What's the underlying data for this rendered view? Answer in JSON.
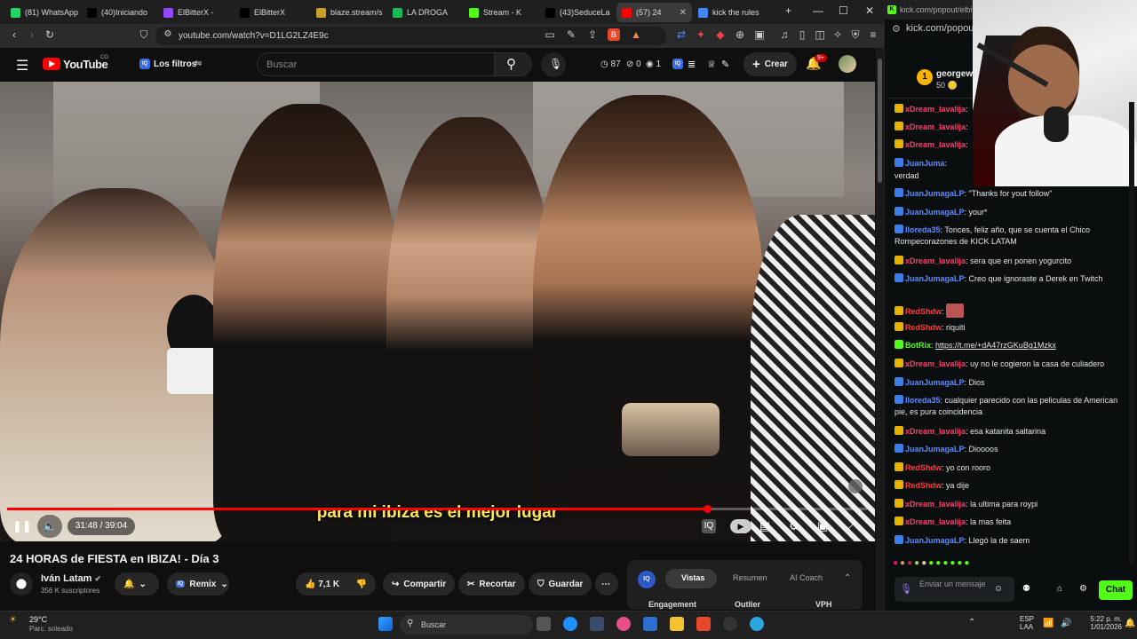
{
  "browser": {
    "tabs": [
      {
        "label": "(81) WhatsApp",
        "color": "#25d366",
        "icon": "whatsapp-icon"
      },
      {
        "label": "(40)Iniciando",
        "color": "#000000",
        "icon": "tiktok-icon"
      },
      {
        "label": "ElBitterX -",
        "color": "#9146ff",
        "icon": "twitch-icon"
      },
      {
        "label": "ElBitterX",
        "color": "#000000",
        "icon": "x-icon"
      },
      {
        "label": "blaze.stream/s",
        "color": "#c8a12a",
        "icon": "blaze-icon"
      },
      {
        "label": "LA DROGA",
        "color": "#1db954",
        "icon": "spotify-icon"
      },
      {
        "label": "Stream - K",
        "color": "#53fc18",
        "icon": "kick-icon"
      },
      {
        "label": "(43)SeduceLa",
        "color": "#000000",
        "icon": "tiktok-icon"
      },
      {
        "label": "(57) 24",
        "color": "#ff0000",
        "icon": "youtube-icon",
        "active": true
      },
      {
        "label": "kick the rules",
        "color": "#4285f4",
        "icon": "google-icon"
      }
    ],
    "url": "youtube.com/watch?v=D1LG2LZ4E9c"
  },
  "youtube": {
    "logo_text": "YouTube",
    "logo_sup": "CO",
    "filters_label": "Los filtros",
    "search_placeholder": "Buscar",
    "stats": {
      "a": "87",
      "b": "0",
      "c": "1"
    },
    "create_label": "Crear",
    "notif_count": "9+",
    "player": {
      "subtitle": "para mi ibiza es el mejor lugar",
      "time": "31:48 / 39:04",
      "progress": 0.814
    },
    "video_title": "24 HORAS de FIESTA en IBIZA! - Día 3",
    "channel_name": "Iván Latam",
    "subscribers": "356 K suscriptores",
    "remix_label": "Remix",
    "likes": "7,1 K",
    "share_label": "Compartir",
    "clip_label": "Recortar",
    "save_label": "Guardar",
    "insights": {
      "tabs": [
        "Vistas",
        "Resumen",
        "AI Coach"
      ],
      "columns": [
        "Engagement",
        "Outlier",
        "VPH"
      ]
    }
  },
  "kick": {
    "popout_url_top": "kick.com/popout/elbitt",
    "popout_url": "kick.com/popout/",
    "top_user": "georgew",
    "top_user_points": "50",
    "chat": [
      {
        "user": "xDream_lavalija",
        "color": "#ff3b6b",
        "msg": ""
      },
      {
        "user": "xDream_lavalija",
        "color": "#ff3b6b",
        "msg": ""
      },
      {
        "user": "xDream_lavalija",
        "color": "#ff3b6b",
        "msg": ""
      },
      {
        "user": "JuanJuma",
        "color": "#5b8cff",
        "msg": ""
      },
      {
        "user": "",
        "color": "#e6e6e6",
        "msg": "verdad"
      },
      {
        "user": "JuanJumagaLP",
        "color": "#5b8cff",
        "msg": "\"Thanks for yout follow\""
      },
      {
        "user": "JuanJumagaLP",
        "color": "#5b8cff",
        "msg": "your*"
      },
      {
        "user": "lloreda35",
        "color": "#5b8cff",
        "msg": "Tonces, feliz año, que se cuenta el Chico Rompecorazones de KICK LATAM"
      },
      {
        "user": "xDream_lavalija",
        "color": "#ff3b6b",
        "msg": "sera que en ponen yogurcito"
      },
      {
        "user": "JuanJumagaLP",
        "color": "#5b8cff",
        "msg": "Creo que ignoraste a Derek en Twitch"
      },
      {
        "user": "RedShdw",
        "color": "#ff3b3b",
        "msg": ""
      },
      {
        "user": "RedShdw",
        "color": "#ff3b3b",
        "msg": "riquiti"
      },
      {
        "user": "BotRix",
        "color": "#53fc18",
        "msg": "https://t.me/+dA47rzGKuBg1Mzkx"
      },
      {
        "user": "xDream_lavalija",
        "color": "#ff3b6b",
        "msg": "uy no le cogieron la casa de culiadero"
      },
      {
        "user": "JuanJumagaLP",
        "color": "#5b8cff",
        "msg": "Dios"
      },
      {
        "user": "lloreda35",
        "color": "#5b8cff",
        "msg": "cualquier parecido con las peliculas de American pie, es pura coincidencia"
      },
      {
        "user": "xDream_lavalija",
        "color": "#ff3b6b",
        "msg": "esa katanita saltarina"
      },
      {
        "user": "JuanJumagaLP",
        "color": "#5b8cff",
        "msg": "Dioooos"
      },
      {
        "user": "RedShdw",
        "color": "#ff3b3b",
        "msg": "yo con rooro"
      },
      {
        "user": "RedShdw",
        "color": "#ff3b3b",
        "msg": "ya dije"
      },
      {
        "user": "xDream_lavalija",
        "color": "#ff3b6b",
        "msg": "la ultima para roypi"
      },
      {
        "user": "xDream_lavalija",
        "color": "#ff3b6b",
        "msg": "la mas feita"
      },
      {
        "user": "JuanJumagaLP",
        "color": "#5b8cff",
        "msg": "Llegó la de saem"
      }
    ],
    "input_placeholder": "Enviar un mensaje",
    "chat_button": "Chat"
  },
  "taskbar": {
    "weather_temp": "29°C",
    "weather_desc": "Parc. soleado",
    "search_label": "Buscar",
    "lang_top": "ESP",
    "lang_bottom": "LAA",
    "time": "5:22 p. m.",
    "date": "1/01/2026"
  }
}
